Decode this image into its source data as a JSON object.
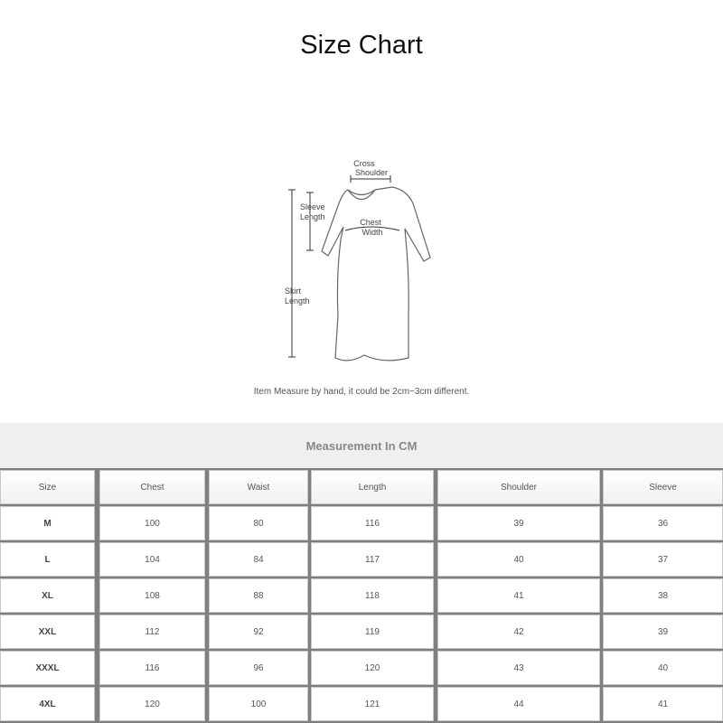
{
  "title": "Size Chart",
  "diagram": {
    "labels": {
      "cross_shoulder_1": "Cross",
      "cross_shoulder_2": "Shoulder",
      "sleeve_length_1": "Sleeve",
      "sleeve_length_2": "Length",
      "chest_width_1": "Chest",
      "chest_width_2": "Width",
      "skirt_length_1": "Skirt",
      "skirt_length_2": "Length"
    }
  },
  "note": "Item Measure by hand, it could be 2cm~3cm different.",
  "table": {
    "title": "Measurement In CM",
    "headers": [
      "Size",
      "Chest",
      "Waist",
      "Length",
      "Shoulder",
      "Sleeve"
    ],
    "rows": [
      [
        "M",
        "100",
        "80",
        "116",
        "39",
        "36"
      ],
      [
        "L",
        "104",
        "84",
        "117",
        "40",
        "37"
      ],
      [
        "XL",
        "108",
        "88",
        "118",
        "41",
        "38"
      ],
      [
        "XXL",
        "112",
        "92",
        "119",
        "42",
        "39"
      ],
      [
        "XXXL",
        "116",
        "96",
        "120",
        "43",
        "40"
      ],
      [
        "4XL",
        "120",
        "100",
        "121",
        "44",
        "41"
      ]
    ]
  }
}
